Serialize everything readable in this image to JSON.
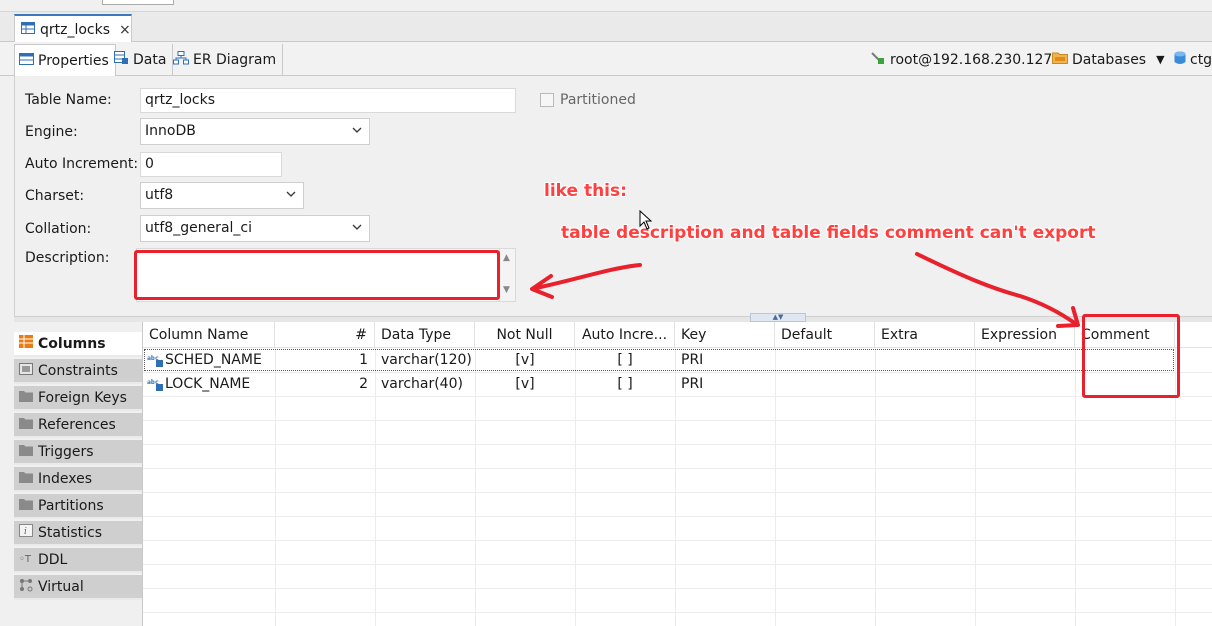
{
  "editor_tab": {
    "title": "qrtz_locks",
    "close": "×"
  },
  "sub_tabs": [
    {
      "label": "Properties"
    },
    {
      "label": "Data"
    },
    {
      "label": "ER Diagram"
    }
  ],
  "connection": {
    "user_host": "root@192.168.230.127",
    "databases": "Databases",
    "db": "ctg"
  },
  "properties": {
    "table_name_label": "Table Name:",
    "table_name": "qrtz_locks",
    "partitioned_label": "Partitioned",
    "engine_label": "Engine:",
    "engine": "InnoDB",
    "auto_increment_label": "Auto Increment:",
    "auto_increment": "0",
    "charset_label": "Charset:",
    "charset": "utf8",
    "collation_label": "Collation:",
    "collation": "utf8_general_ci",
    "description_label": "Description:",
    "description": ""
  },
  "side_tabs": [
    {
      "label": "Columns"
    },
    {
      "label": "Constraints"
    },
    {
      "label": "Foreign Keys"
    },
    {
      "label": "References"
    },
    {
      "label": "Triggers"
    },
    {
      "label": "Indexes"
    },
    {
      "label": "Partitions"
    },
    {
      "label": "Statistics"
    },
    {
      "label": "DDL"
    },
    {
      "label": "Virtual"
    }
  ],
  "grid": {
    "headers": [
      "Column Name",
      "#",
      "Data Type",
      "Not Null",
      "Auto Incre...",
      "Key",
      "Default",
      "Extra",
      "Expression",
      "Comment"
    ],
    "rows": [
      {
        "name": "SCHED_NAME",
        "num": "1",
        "type": "varchar(120)",
        "not_null": "[v]",
        "auto_inc": "[ ]",
        "key": "PRI"
      },
      {
        "name": "LOCK_NAME",
        "num": "2",
        "type": "varchar(40)",
        "not_null": "[v]",
        "auto_inc": "[ ]",
        "key": "PRI"
      }
    ]
  },
  "annotations": {
    "line1": "like this:",
    "line2": "table description and table fields comment can't export"
  },
  "colors": {
    "annotation_red": "#e8212d",
    "accent": "#3a78c2"
  }
}
